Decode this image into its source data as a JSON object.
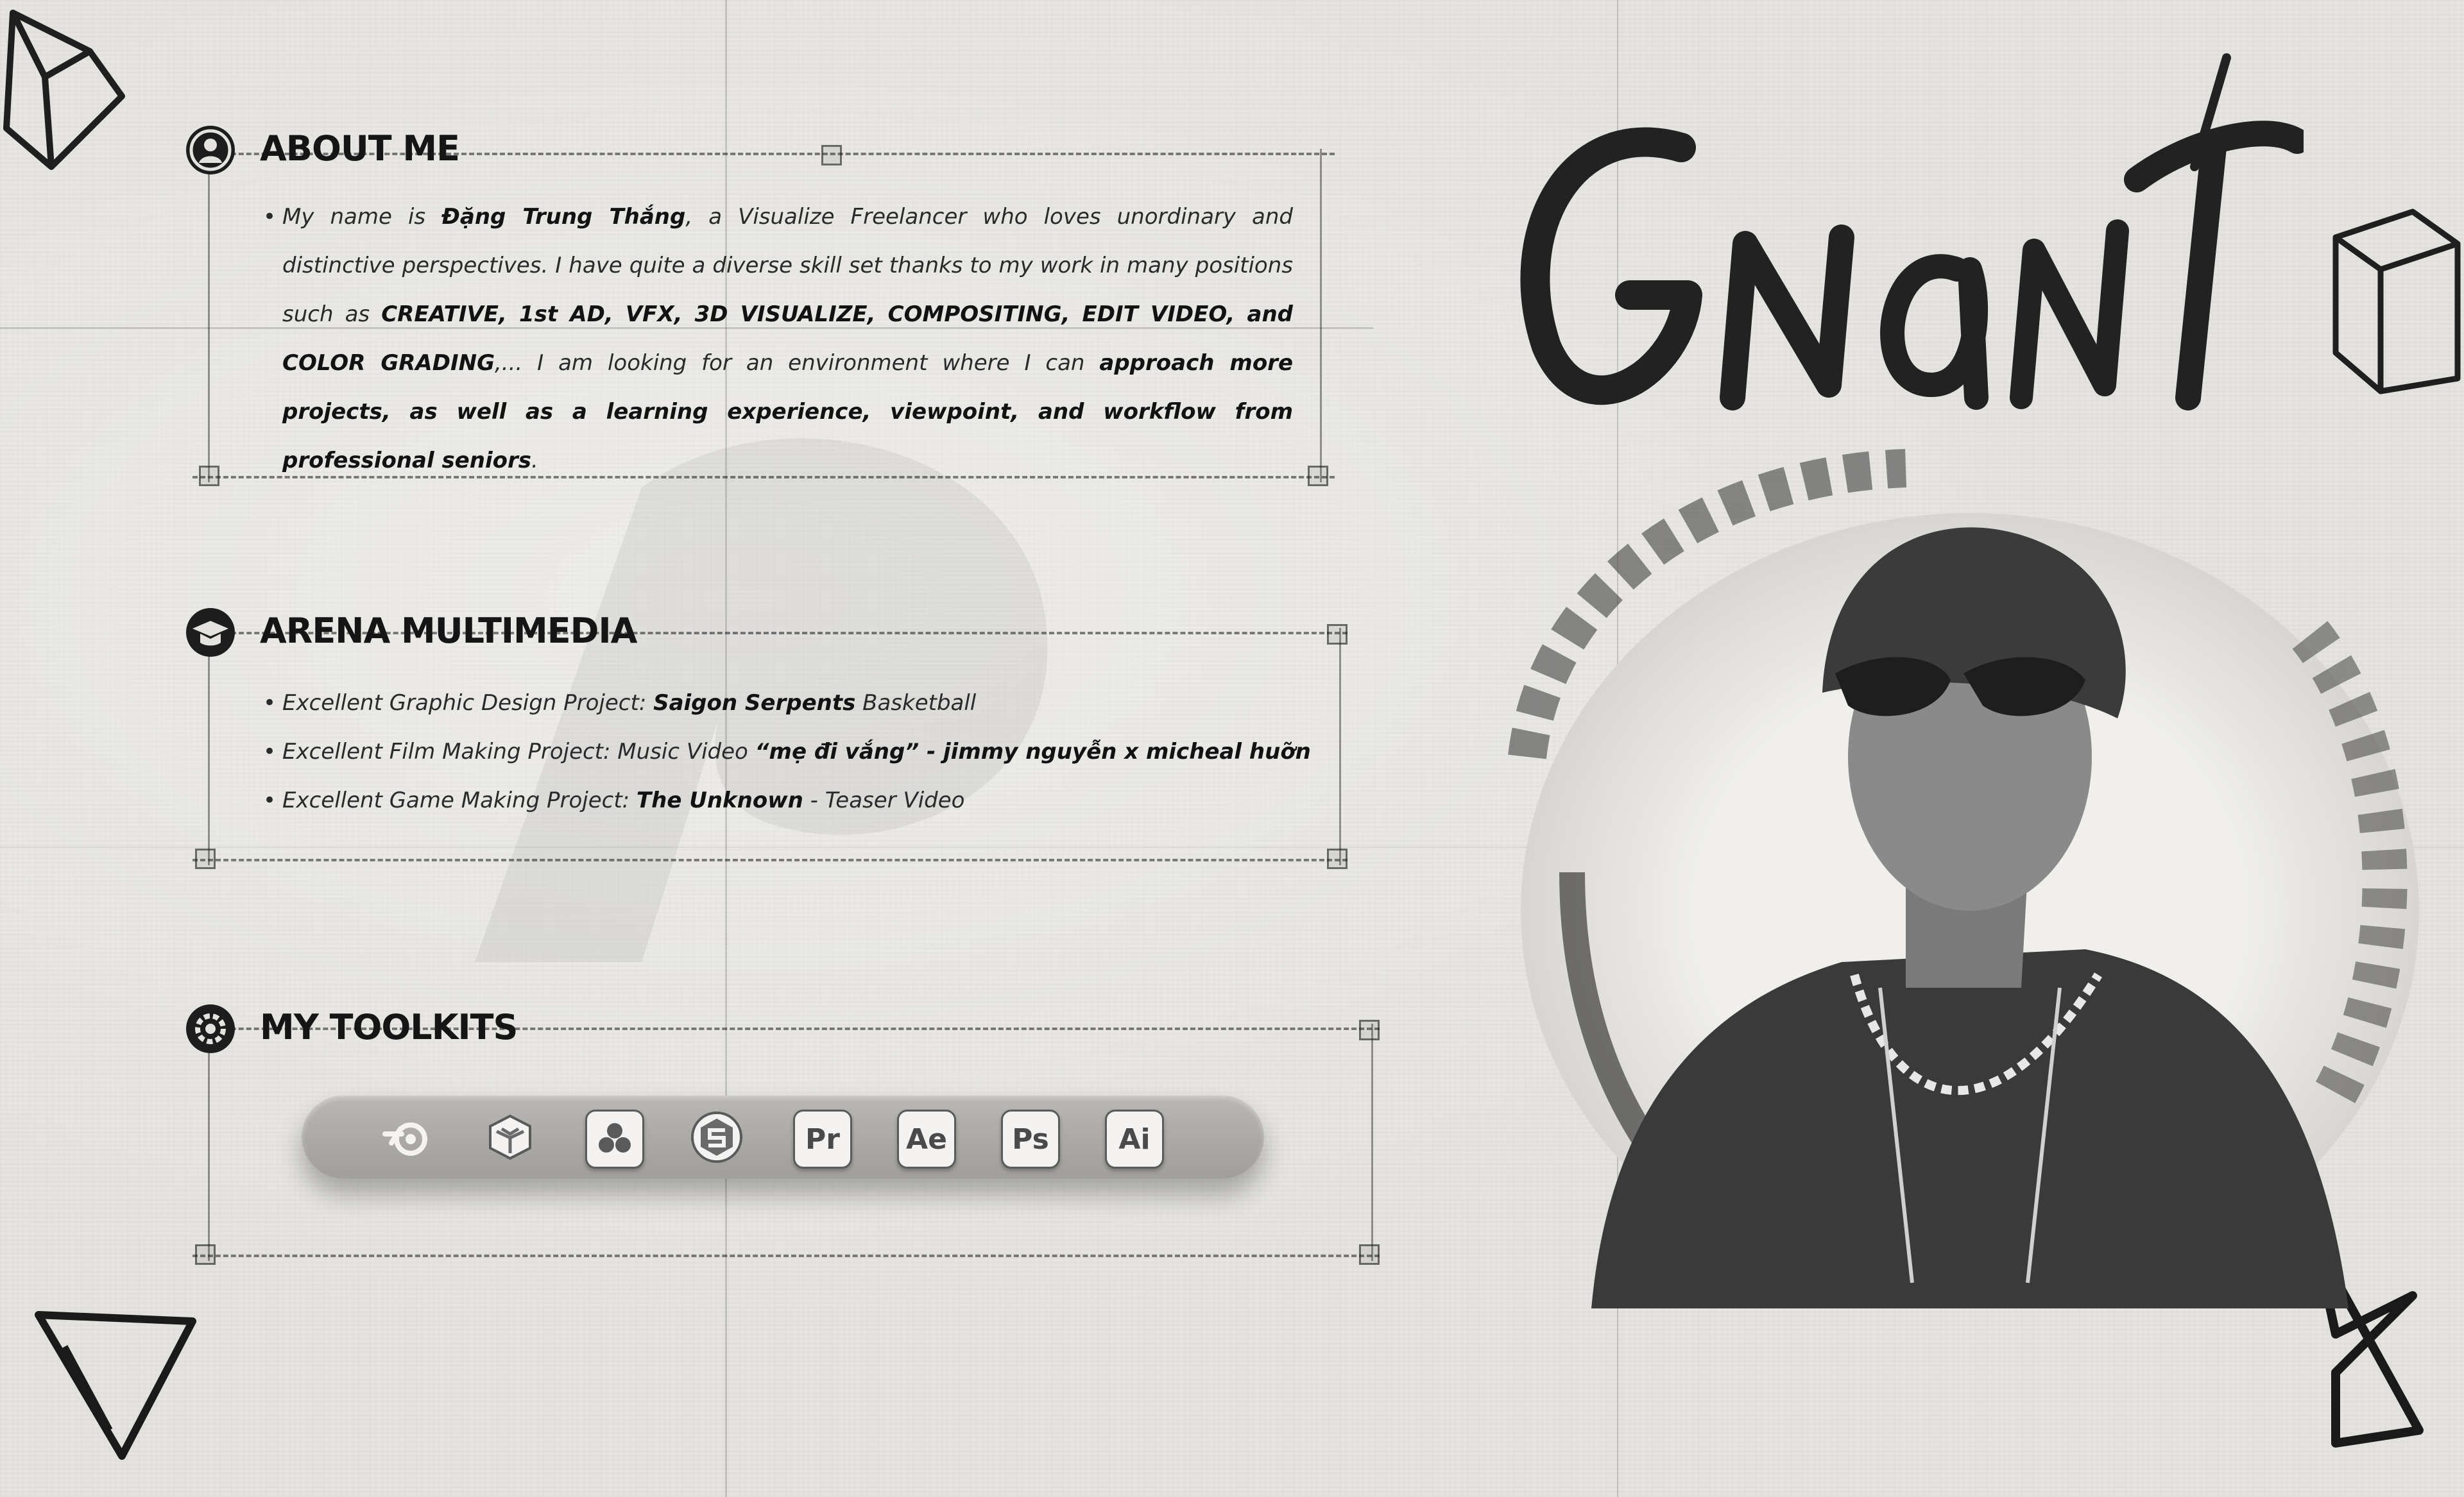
{
  "about": {
    "title": "ABOUT ME",
    "p1": "My name is ",
    "name": "Đặng Trung Thắng",
    "p2": ", a Visualize Freelancer who loves unordinary and distinctive perspectives. I have quite a diverse skill set thanks to my work in many positions such as ",
    "skills": "CREATIVE, 1st AD, VFX, 3D VISUALIZE, COMPOSITING, EDIT VIDEO, and COLOR GRADING",
    "p3": ",... I am looking for an environment where I can ",
    "goal": "approach more projects, as well as a learning experience, viewpoint, and workflow from professional seniors",
    "p4": "."
  },
  "arena": {
    "title": "ARENA MULTIMEDIA",
    "items": [
      {
        "prefix": "Excellent Graphic Design Project: ",
        "highlight": "Saigon Serpents",
        "suffix": " Basketball"
      },
      {
        "prefix": "Excellent Film Making Project: Music Video ",
        "highlight": "“mẹ đi vắng” - jimmy nguyễn x micheal huỡn",
        "suffix": ""
      },
      {
        "prefix": "Excellent Game Making Project: ",
        "highlight": "The Unknown",
        "suffix": " - Teaser Video"
      }
    ]
  },
  "toolkits": {
    "title": "MY TOOLKITS",
    "tools": [
      {
        "icon": "blender-icon"
      },
      {
        "icon": "cinema4d-cube-icon"
      },
      {
        "icon": "davinci-resolve-icon"
      },
      {
        "icon": "substance-icon"
      },
      {
        "icon": "premiere-pro-icon",
        "label": "Pr"
      },
      {
        "icon": "after-effects-icon",
        "label": "Ae"
      },
      {
        "icon": "photoshop-icon",
        "label": "Ps"
      },
      {
        "icon": "illustrator-icon",
        "label": "Ai"
      }
    ]
  },
  "signature": {
    "text": "Gnant"
  },
  "colors": {
    "ink": "#151515",
    "paper": "#e5e3df",
    "toolbar": "#a9a7a3"
  }
}
